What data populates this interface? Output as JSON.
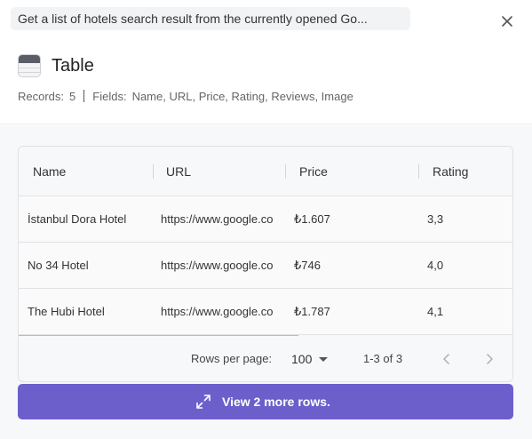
{
  "task": {
    "text": "Get a list of hotels search result from the currently opened Go..."
  },
  "header": {
    "title": "Table",
    "records_label": "Records:",
    "records_value": "5",
    "fields_label": "Fields:",
    "fields_value": "Name, URL, Price, Rating, Reviews, Image",
    "close_icon": "close-icon",
    "table_icon": "table-icon"
  },
  "table": {
    "columns": [
      "Name",
      "URL",
      "Price",
      "Rating"
    ],
    "rows": [
      {
        "name": "İstanbul Dora Hotel",
        "url": "https://www.google.co",
        "price": "₺1.607",
        "rating": "3,3"
      },
      {
        "name": "No 34 Hotel",
        "url": "https://www.google.co",
        "price": "₺746",
        "rating": "4,0"
      },
      {
        "name": "The Hubi Hotel",
        "url": "https://www.google.co",
        "price": "₺1.787",
        "rating": "4,1"
      }
    ]
  },
  "pagination": {
    "rows_per_page_label": "Rows per page:",
    "rows_per_page_value": "100",
    "range_text": "1-3 of 3",
    "prev_icon": "chevron-left-icon",
    "next_icon": "chevron-right-icon"
  },
  "more_button": {
    "label": "View 2 more rows.",
    "icon": "expand-icon"
  },
  "colors": {
    "accent": "#6c5fcb",
    "background": "#f7f8fa"
  }
}
